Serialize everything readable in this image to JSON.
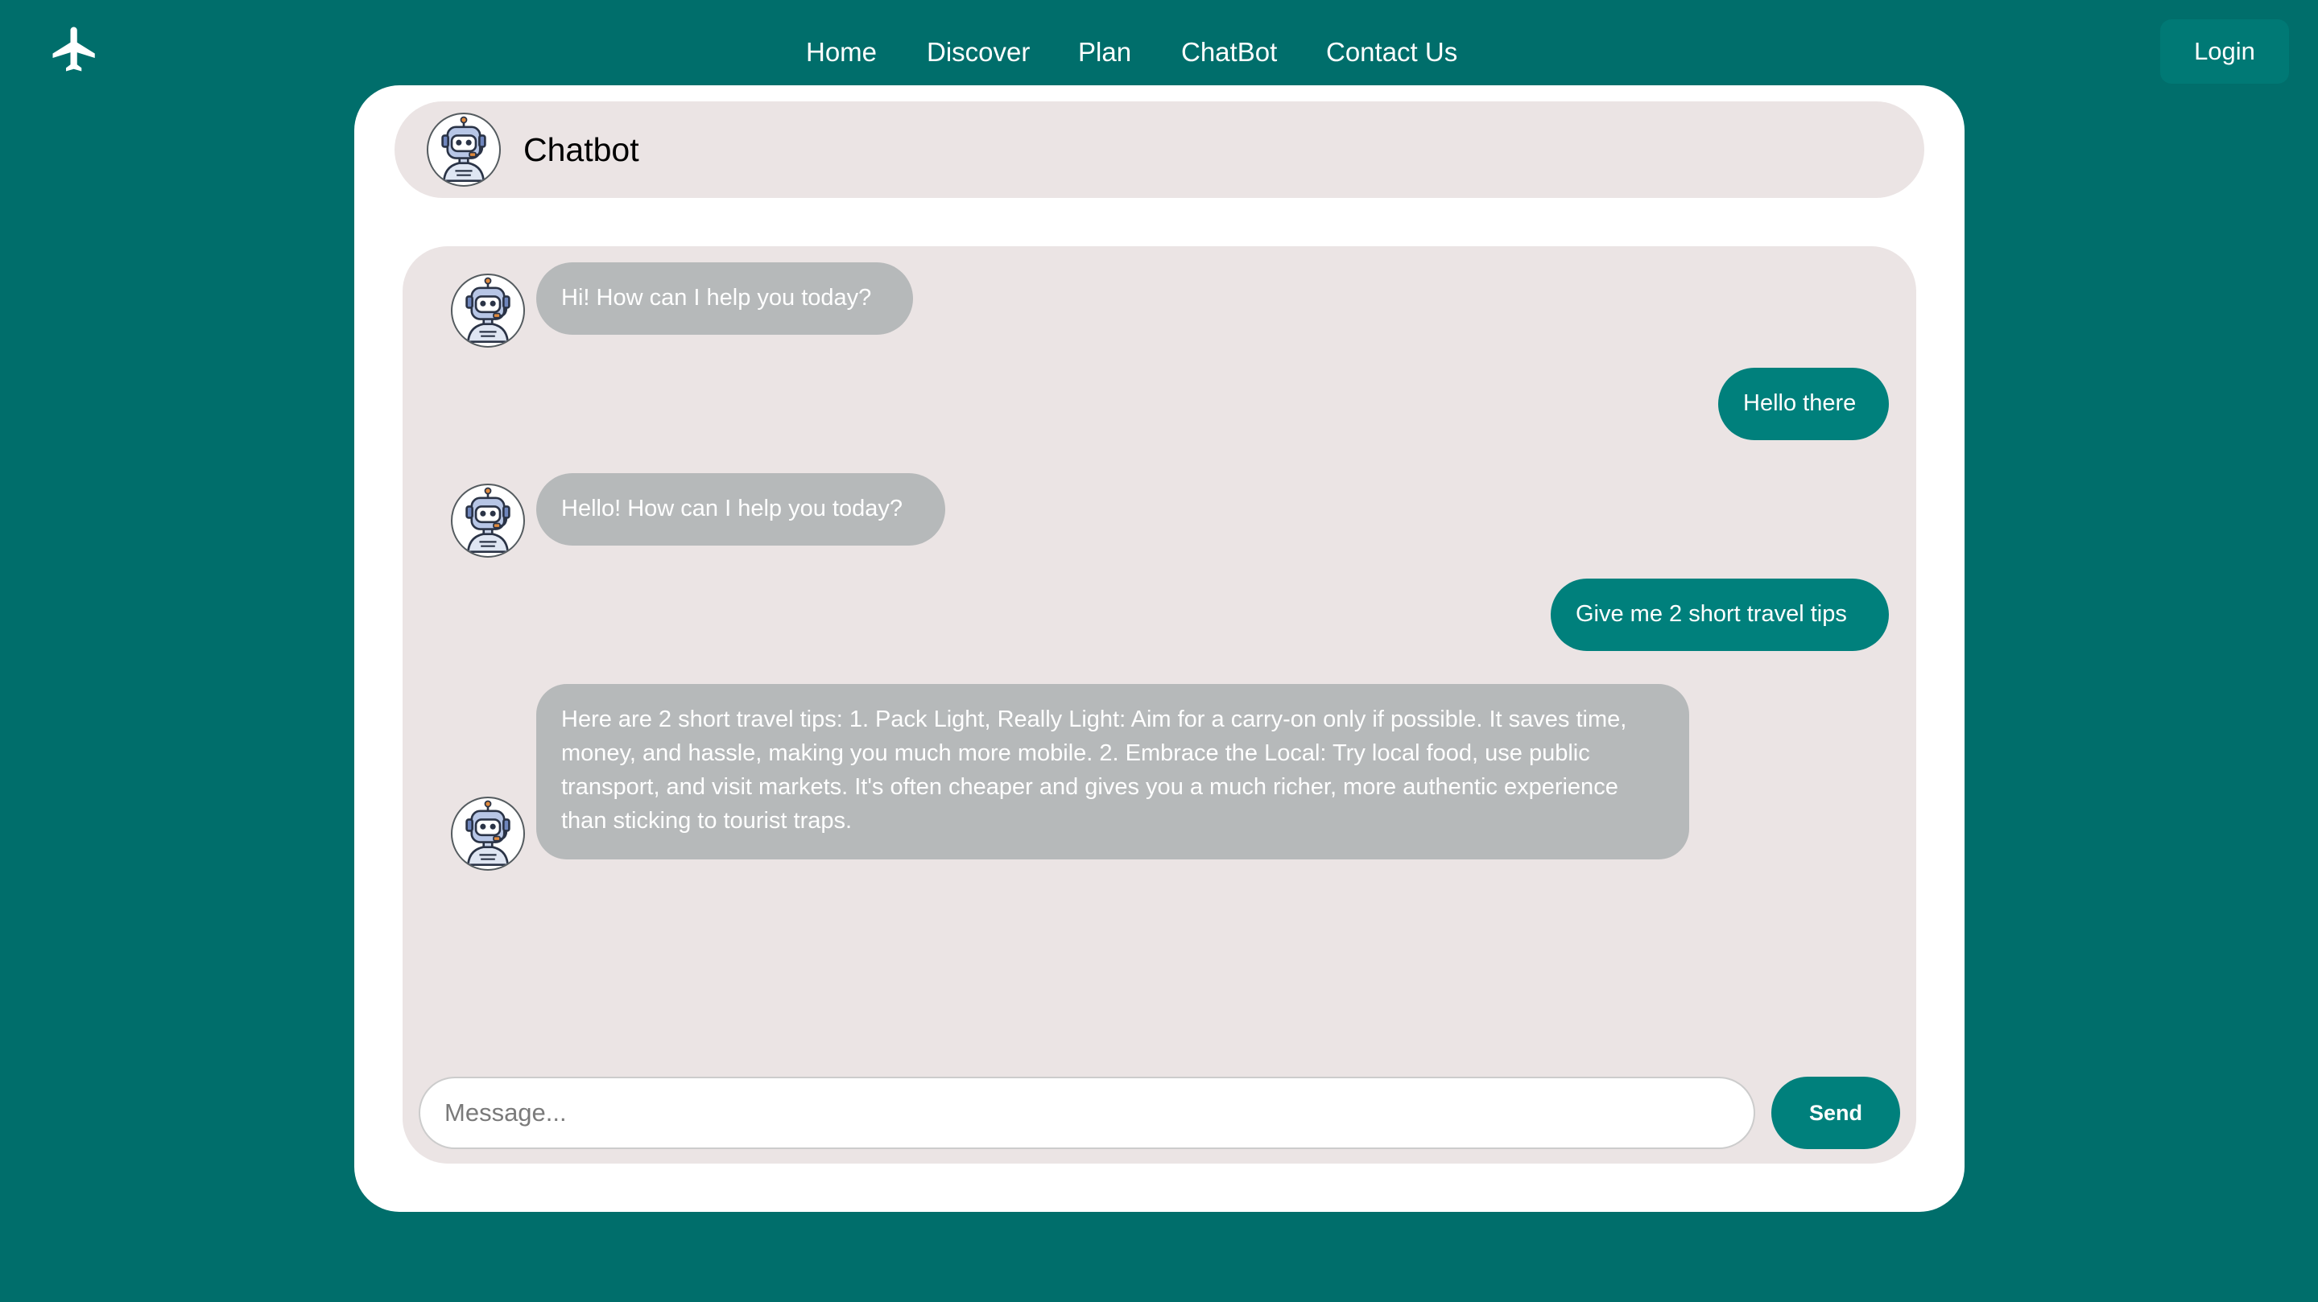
{
  "nav": {
    "links": [
      "Home",
      "Discover",
      "Plan",
      "ChatBot",
      "Contact Us"
    ],
    "login_label": "Login"
  },
  "header": {
    "title": "Chatbot"
  },
  "messages": [
    {
      "sender": "bot",
      "text": "Hi! How can I help you today?"
    },
    {
      "sender": "user",
      "text": "Hello there"
    },
    {
      "sender": "bot",
      "text": "Hello! How can I help you today?"
    },
    {
      "sender": "user",
      "text": "Give me 2 short travel tips"
    },
    {
      "sender": "bot",
      "text": "Here are 2 short travel tips: 1. Pack Light, Really Light: Aim for a carry-on only if possible. It saves time, money, and hassle, making you much more mobile. 2. Embrace the Local: Try local food, use public transport, and visit markets. It's often cheaper and gives you a much richer, more authentic experience than sticking to tourist traps."
    }
  ],
  "composer": {
    "placeholder": "Message...",
    "value": "",
    "send_label": "Send"
  },
  "colors": {
    "background": "#006e6b",
    "accent": "#00807c",
    "panel": "#ebe4e4",
    "bot_bubble": "#b6b9ba",
    "card": "#ffffff"
  },
  "icons": {
    "logo": "airplane-icon",
    "avatar": "robot-icon"
  }
}
